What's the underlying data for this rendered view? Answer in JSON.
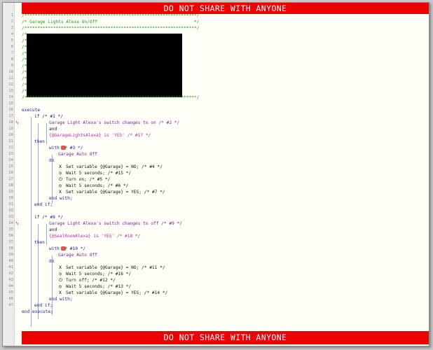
{
  "banner": "DO NOT SHARE WITH ANYONE",
  "lines": [
    "/******************************************************************/",
    "/* Garage Lights Alexa On/Off                                     */",
    "/******************************************************************/",
    "/*",
    "/*",
    "/*",
    "/*",
    "/*",
    "/*",
    "/*",
    "/*",
    "/*",
    "/*",
    "/******************************************************************/",
    "",
    "execute",
    "if /* #1 */",
    "Garage Light Alexa's switch changes to on /* #2 */",
    "and",
    "{@GarageLightsAlexa} is 'YES' /* #17 */",
    "then",
    "with /* #3 */",
    "Garage Auto Off",
    "do",
    "Set variable {@Garage} = NO; /* #4 */",
    "Wait 5 seconds; /* #15 */",
    "Turn on; /* #5 */",
    "Wait 5 seconds; /* #6 */",
    "Set variable {@Garage} = YES; /* #7 */",
    "end with;",
    "end if;",
    "if /* #8 */",
    "Garage Light Alexa's switch changes to off /* #9 */",
    "and",
    "{@SealRoomAlexa} is 'YES' /* #18 */",
    "then",
    "with /* #10 */",
    "Garage Auto Off",
    "do",
    "Set variable {@Garage} = NO; /* #11 */",
    "Wait 5 seconds; /* #16 */",
    "Turn off; /* #12 */",
    "Wait 5 seconds; /* #13 */",
    "Set variable {@Garage} = YES; /* #14 */",
    "end with;",
    "end if;",
    "end execute;"
  ]
}
